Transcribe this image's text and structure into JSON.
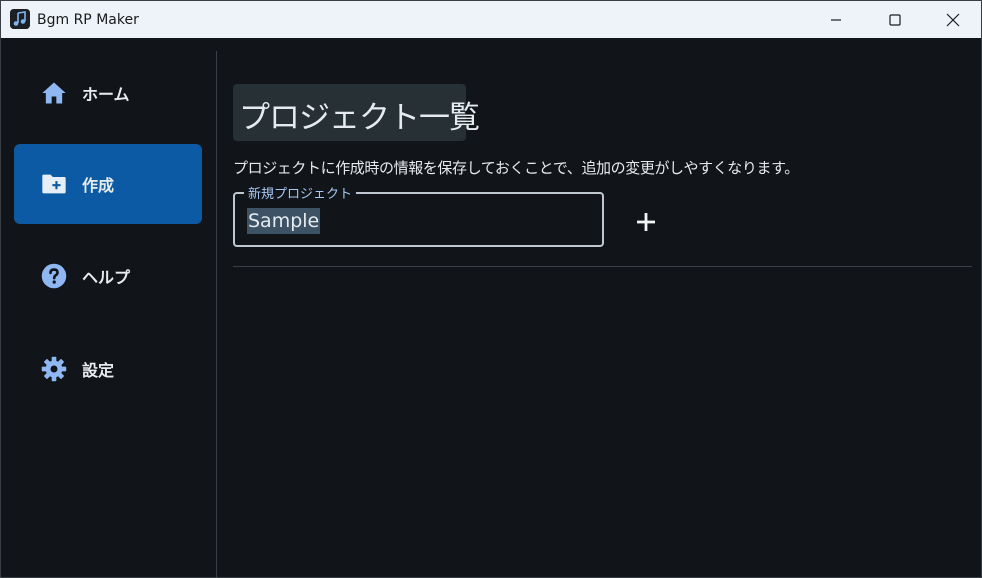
{
  "window": {
    "title": "Bgm RP Maker",
    "icon": "app-music-icon",
    "controls": [
      "minimize-icon",
      "maximize-icon",
      "close-icon"
    ]
  },
  "sidebar": {
    "items": [
      {
        "label": "ホーム",
        "icon": "home-icon",
        "active": false
      },
      {
        "label": "作成",
        "icon": "folder-plus-icon",
        "active": true
      },
      {
        "label": "ヘルプ",
        "icon": "help-icon",
        "active": false
      },
      {
        "label": "設定",
        "icon": "gear-icon",
        "active": false
      }
    ]
  },
  "main": {
    "title": "プロジェクト一覧",
    "description": "プロジェクトに作成時の情報を保存しておくことで、追加の変更がしやすくなります。",
    "new_project": {
      "label": "新規プロジェクト",
      "value": "Sample"
    },
    "add_button_icon": "plus-icon"
  },
  "colors": {
    "background": "#111418",
    "titlebar": "#eef3f9",
    "accent": "#0b5aa3",
    "nav_icon": "#8fb8f2",
    "field_label": "#a7c8f5",
    "title_box": "#263035",
    "selection": "#3e5266"
  }
}
